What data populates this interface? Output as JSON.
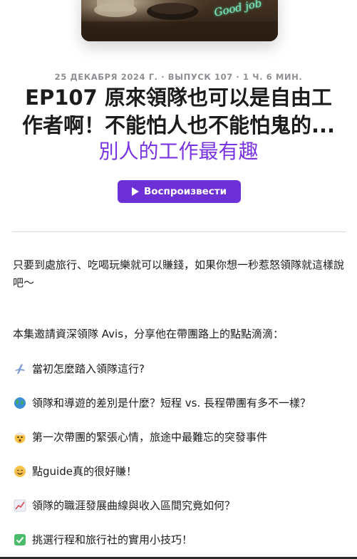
{
  "episode": {
    "meta": "25 ДЕКАБРЯ 2024 Г. · ВЫПУСК 107 · 1 Ч. 6 МИН.",
    "title_line1": "EP107 原來領隊也可以是自由工",
    "title_line2": "作者啊！不能怕人也不能怕鬼的...",
    "author": "別人的工作最有趣",
    "play_label": "Воспроизвести",
    "cover_text": "Good job"
  },
  "description": {
    "intro": "只要到處旅行、吃喝玩樂就可以賺錢，如果你想一秒惹怒領隊就這樣說吧～",
    "guest_line": "本集邀請資深領隊 Avis，分享他在帶團路上的點點滴滴：",
    "bullets": [
      {
        "icon": "airplane-icon",
        "text": "當初怎麼踏入領隊這行?"
      },
      {
        "icon": "globe-icon",
        "text": "領隊和導遊的差別是什麼？短程 vs. 長程帶團有多不一樣？"
      },
      {
        "icon": "shocked-face-icon",
        "text": "第一次帶團的緊張心情，旅途中最難忘的突發事件"
      },
      {
        "icon": "smiling-face-icon",
        "text": "點guide真的很好賺！"
      },
      {
        "icon": "chart-increasing-icon",
        "text": "領隊的職涯發展曲線與收入區間究竟如何？"
      },
      {
        "icon": "check-mark-icon",
        "text": "挑選行程和旅行社的實用小技巧！"
      }
    ]
  },
  "colors": {
    "accent": "#6d2fd6",
    "author": "#7a34e0",
    "meta": "#8e8e93",
    "text": "#1c1c1e"
  }
}
